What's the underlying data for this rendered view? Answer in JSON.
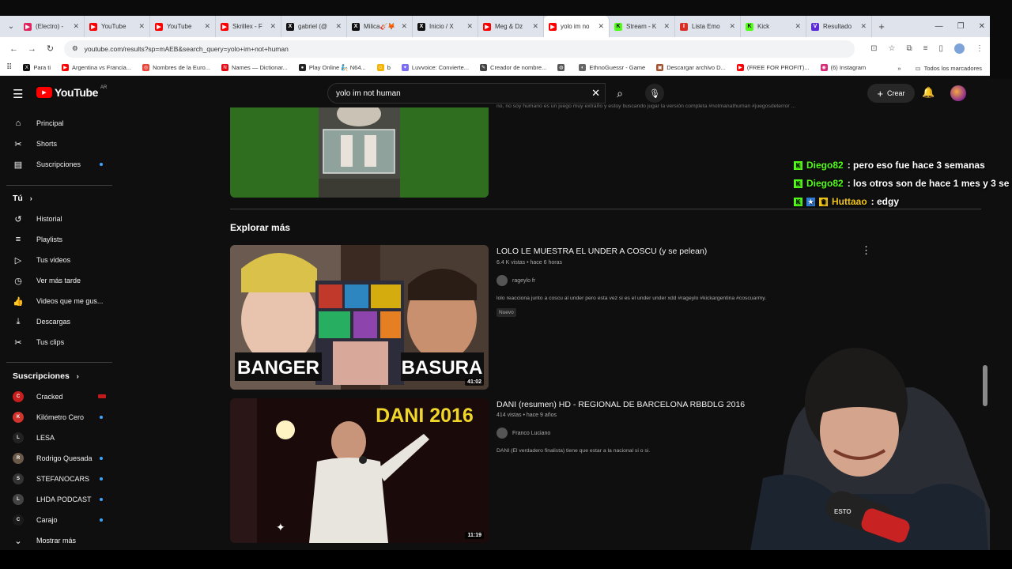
{
  "browser": {
    "tabs": [
      {
        "title": "(Electro) -",
        "fav_color": "#e0245e",
        "fav": "▶"
      },
      {
        "title": "YouTube",
        "fav_color": "#ff0000",
        "fav": "▶"
      },
      {
        "title": "YouTube",
        "fav_color": "#ff0000",
        "fav": "▶"
      },
      {
        "title": "Skrillex - F",
        "fav_color": "#ff0000",
        "fav": "▶"
      },
      {
        "title": "gabriel (@",
        "fav_color": "#111111",
        "fav": "X"
      },
      {
        "title": "Milica🎸🦊",
        "fav_color": "#111111",
        "fav": "X"
      },
      {
        "title": "Inicio / X",
        "fav_color": "#111111",
        "fav": "X"
      },
      {
        "title": "Meg & Dz",
        "fav_color": "#ff0000",
        "fav": "▶"
      },
      {
        "title": "yolo im no",
        "fav_color": "#ff0000",
        "fav": "▶"
      },
      {
        "title": "Stream - K",
        "fav_color": "#53fc18",
        "fav": "K"
      },
      {
        "title": "Lista Emo",
        "fav_color": "#d93025",
        "fav": "I"
      },
      {
        "title": "Kick",
        "fav_color": "#53fc18",
        "fav": "K"
      },
      {
        "title": "Resultado",
        "fav_color": "#5b2bd6",
        "fav": "V"
      }
    ],
    "url": "youtube.com/results?sp=mAEB&search_query=yolo+im+not+human",
    "bookmarks": [
      {
        "label": "Para ti",
        "color": "#111111",
        "fav": "X"
      },
      {
        "label": "Argentina vs Francia...",
        "color": "#ff0000",
        "fav": "▶"
      },
      {
        "label": "Nombres de la Euro...",
        "color": "#e8453c",
        "fav": "◎"
      },
      {
        "label": "Names — Dictionar...",
        "color": "#e50914",
        "fav": "N"
      },
      {
        "label": "Play Online 🧞 N64...",
        "color": "#222222",
        "fav": "●"
      },
      {
        "label": "b",
        "color": "#f5b400",
        "fav": "☺"
      },
      {
        "label": "Luvvoice: Convierte...",
        "color": "#7b6cf6",
        "fav": "✦"
      },
      {
        "label": "Creador de nombre...",
        "color": "#444444",
        "fav": "✎"
      },
      {
        "label": "",
        "color": "#555555",
        "fav": "◍"
      },
      {
        "label": "EthnoGuessr - Game",
        "color": "#666666",
        "fav": "◐"
      },
      {
        "label": "Descargar archivo D...",
        "color": "#a0522d",
        "fav": "▣"
      },
      {
        "label": "(FREE FOR PROFIT)...",
        "color": "#ff0000",
        "fav": "▶"
      },
      {
        "label": "(6) Instagram",
        "color": "#d62976",
        "fav": "◉"
      }
    ],
    "bookmarks_more": "»",
    "all_bookmarks": "Todos los marcadores"
  },
  "youtube": {
    "logo_text": "YouTube",
    "region": "AR",
    "search_query": "yolo im not human",
    "create_label": "Crear",
    "sidebar": {
      "main": [
        {
          "label": "Principal",
          "icon": "⌂"
        },
        {
          "label": "Shorts",
          "icon": "✂"
        },
        {
          "label": "Suscripciones",
          "icon": "▤"
        }
      ],
      "you_header": "Tú",
      "you_items": [
        {
          "label": "Historial",
          "icon": "↺"
        },
        {
          "label": "Playlists",
          "icon": "≡"
        },
        {
          "label": "Tus videos",
          "icon": "▷"
        },
        {
          "label": "Ver más tarde",
          "icon": "◷"
        },
        {
          "label": "Videos que me gus...",
          "icon": "👍"
        },
        {
          "label": "Descargas",
          "icon": "⤓"
        },
        {
          "label": "Tus clips",
          "icon": "✂"
        }
      ],
      "subs_header": "Suscripciones",
      "subs": [
        {
          "label": "Cracked",
          "color": "#c81e1e",
          "initial": "C"
        },
        {
          "label": "Kilómetro Cero",
          "color": "#d0342c",
          "initial": "K"
        },
        {
          "label": "LESA",
          "color": "#222222",
          "initial": "L"
        },
        {
          "label": "Rodrigo Quesada",
          "color": "#6b5a4a",
          "initial": "R"
        },
        {
          "label": "STEFANOCARS",
          "color": "#333333",
          "initial": "S"
        },
        {
          "label": "LHDA PODCAST",
          "color": "#444444",
          "initial": "L"
        },
        {
          "label": "Carajo",
          "color": "#1a1a1a",
          "initial": "C"
        }
      ],
      "more_label": "Mostrar más"
    },
    "prev_desc": "no, no soy humano es un juego muy extraño y estoy buscando jugar la versión completa #notmanathuman #juegosdeterror ...",
    "section_title": "Explorar más",
    "videos": [
      {
        "title": "LOLO LE MUESTRA EL UNDER A COSCU (y se pelean)",
        "meta": "6.4 K vistas • hace 6 horas",
        "channel": "rageylo fr",
        "desc": "lolo reacciona junto a coscu al under pero esta vez si es el under under xdd #rageylo #kickargentina #coscuarmy.",
        "badge": "Nuevo",
        "duration": "41:02",
        "thumb_left": "BANGER",
        "thumb_right": "BASURA"
      },
      {
        "title": "DANI (resumen) HD - REGIONAL DE BARCELONA RBBDLG 2016",
        "meta": "414 vistas • hace 9 años",
        "channel": "Franco Luciano",
        "desc": "DANI (El verdadero finalista) tiene que estar a la nacional si o si.",
        "duration": "11:19",
        "thumb_text": "DANI 2016"
      }
    ]
  },
  "chat": [
    {
      "user": "Diego82",
      "user_color": "#53fc18",
      "message": ": pero eso fue hace 3 semanas"
    },
    {
      "user": "Diego82",
      "user_color": "#53fc18",
      "message": ": los otros son de hace 1 mes y 3 se"
    },
    {
      "user": "Huttaao",
      "user_color": "#f0c419",
      "message": ": edgy"
    }
  ]
}
